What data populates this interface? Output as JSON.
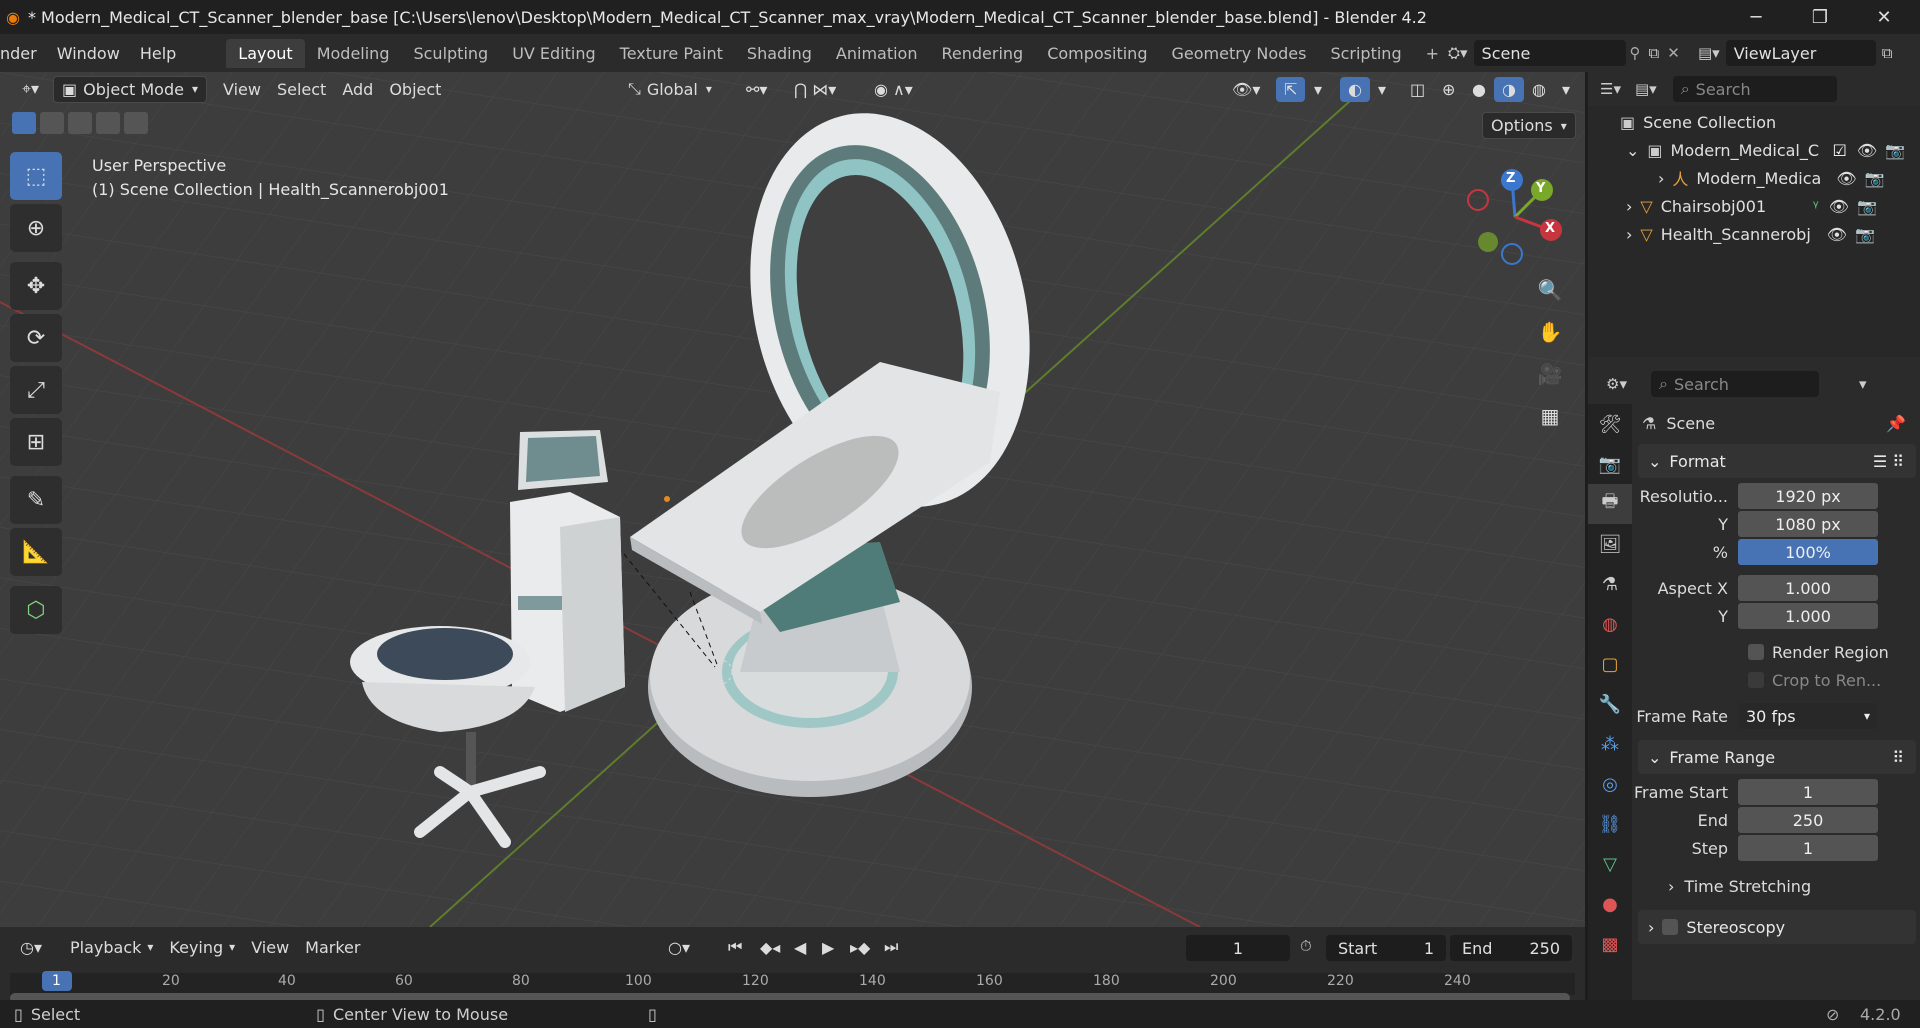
{
  "window": {
    "title": "* Modern_Medical_CT_Scanner_blender_base [C:\\Users\\lenov\\Desktop\\Modern_Medical_CT_Scanner_max_vray\\Modern_Medical_CT_Scanner_blender_base.blend] - Blender 4.2",
    "minimize": "─",
    "restore": "❐",
    "close": "✕"
  },
  "menu": [
    "nder",
    "Window",
    "Help"
  ],
  "workspaces": [
    "Layout",
    "Modeling",
    "Sculpting",
    "UV Editing",
    "Texture Paint",
    "Shading",
    "Animation",
    "Rendering",
    "Compositing",
    "Geometry Nodes",
    "Scripting"
  ],
  "add_workspace": "+",
  "scene_field": "Scene",
  "viewlayer_field": "ViewLayer",
  "viewport_header": {
    "mode": "Object Mode",
    "menus": [
      "View",
      "Select",
      "Add",
      "Object"
    ],
    "transform_orientation": "Global",
    "options": "Options"
  },
  "viewport_overlay": {
    "perspective": "User Perspective",
    "collection_info": "(1) Scene Collection | Health_Scannerobj001"
  },
  "gizmo": {
    "x": "X",
    "y": "Y",
    "z": "Z"
  },
  "outliner": {
    "search_placeholder": "Search",
    "root": "Scene Collection",
    "rows": [
      "Modern_Medical_C",
      "Modern_Medica",
      "Chairsobj001",
      "Health_Scannerobj"
    ]
  },
  "properties": {
    "search_placeholder": "Search",
    "context": "Scene",
    "format_panel": "Format",
    "resolution_x_label": "Resolutio...",
    "resolution_x": "1920 px",
    "resolution_y_label": "Y",
    "resolution_y": "1080 px",
    "percent_label": "%",
    "percent": "100%",
    "aspect_x_label": "Aspect X",
    "aspect_x": "1.000",
    "aspect_y_label": "Y",
    "aspect_y": "1.000",
    "render_region": "Render Region",
    "crop_region": "Crop to Ren...",
    "frame_rate_label": "Frame Rate",
    "frame_rate": "30 fps",
    "frame_range_panel": "Frame Range",
    "frame_start_label": "Frame Start",
    "frame_start": "1",
    "end_label": "End",
    "end": "250",
    "step_label": "Step",
    "step": "1",
    "time_stretching": "Time Stretching",
    "stereoscopy": "Stereoscopy"
  },
  "timeline": {
    "menus": [
      "Playback",
      "Keying",
      "View",
      "Marker"
    ],
    "current_frame": "1",
    "start_label": "Start",
    "start": "1",
    "end_label": "End",
    "end": "250",
    "ruler": [
      "1",
      "20",
      "40",
      "60",
      "80",
      "100",
      "120",
      "140",
      "160",
      "180",
      "200",
      "220",
      "240"
    ]
  },
  "statusbar": {
    "select": "Select",
    "center_view": "Center View to Mouse",
    "version": "4.2.0"
  },
  "colors": {
    "accent": "#4772b3",
    "x_axis": "#c7353f",
    "y_axis": "#7aa82b",
    "z_axis": "#3b77cf"
  }
}
